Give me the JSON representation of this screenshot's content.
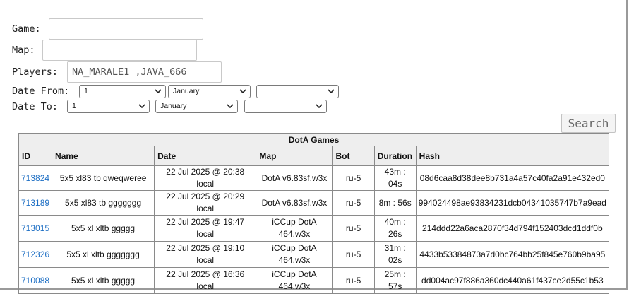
{
  "form": {
    "game_label": "Game:",
    "game_value": "",
    "map_label": "Map:",
    "map_value": "",
    "players_label": "Players:",
    "players_value": "NA_MARALE1 ,JAVA_666",
    "date_from_label": "Date From:",
    "date_from_day": "1",
    "date_from_month": "January",
    "date_from_year": "",
    "date_to_label": "Date To:",
    "date_to_day": "1",
    "date_to_month": "January",
    "date_to_year": "",
    "search_label": "Search"
  },
  "table": {
    "title": "DotA Games",
    "headers": [
      "ID",
      "Name",
      "Date",
      "Map",
      "Bot",
      "Duration",
      "Hash"
    ],
    "rows": [
      {
        "id": "713824",
        "name": "5x5 xl83 tb qweqweree",
        "date": "22 Jul 2025 @ 20:38 local",
        "map_line1": "DotA v6.83sf.w3x",
        "map_line2": "",
        "bot": "ru-5",
        "duration": "43m : 04s",
        "hash": "08d6caa8d38dee8b731a4a57c40fa2a91e432ed0"
      },
      {
        "id": "713189",
        "name": "5x5 xl83 tb ggggggg",
        "date": "22 Jul 2025 @ 20:29 local",
        "map_line1": "DotA v6.83sf.w3x",
        "map_line2": "",
        "bot": "ru-5",
        "duration": "8m : 56s",
        "hash": "994024498ae93834231dcb04341035747b7a9ead"
      },
      {
        "id": "713015",
        "name": "5x5 xl xltb ggggg",
        "date": "22 Jul 2025 @ 19:47 local",
        "map_line1": "iCCup DotA",
        "map_line2": "464.w3x",
        "bot": "ru-5",
        "duration": "40m : 26s",
        "hash": "214ddd22a6aca2870f34d794f152403dcd1ddf0b"
      },
      {
        "id": "712326",
        "name": "5x5 xl xltb ggggggg",
        "date": "22 Jul 2025 @ 19:10 local",
        "map_line1": "iCCup DotA",
        "map_line2": "464.w3x",
        "bot": "ru-5",
        "duration": "31m : 02s",
        "hash": "4433b53384873a7d0bc764bb25f845e760b9ba95"
      },
      {
        "id": "710088",
        "name": "5x5 xl xltb ggggg",
        "date": "22 Jul 2025 @ 16:36 local",
        "map_line1": "iCCup DotA",
        "map_line2": "464.w3x",
        "bot": "ru-5",
        "duration": "25m : 57s",
        "hash": "dd004ac97f886a360dc440a61f437ce2d55c1b53"
      }
    ]
  },
  "colors": {
    "link": "#1e6fc4",
    "header_bg": "#eeeeee",
    "border": "#8a8a8a"
  },
  "icons": {
    "select_arrow": "chevron-down-icon"
  }
}
